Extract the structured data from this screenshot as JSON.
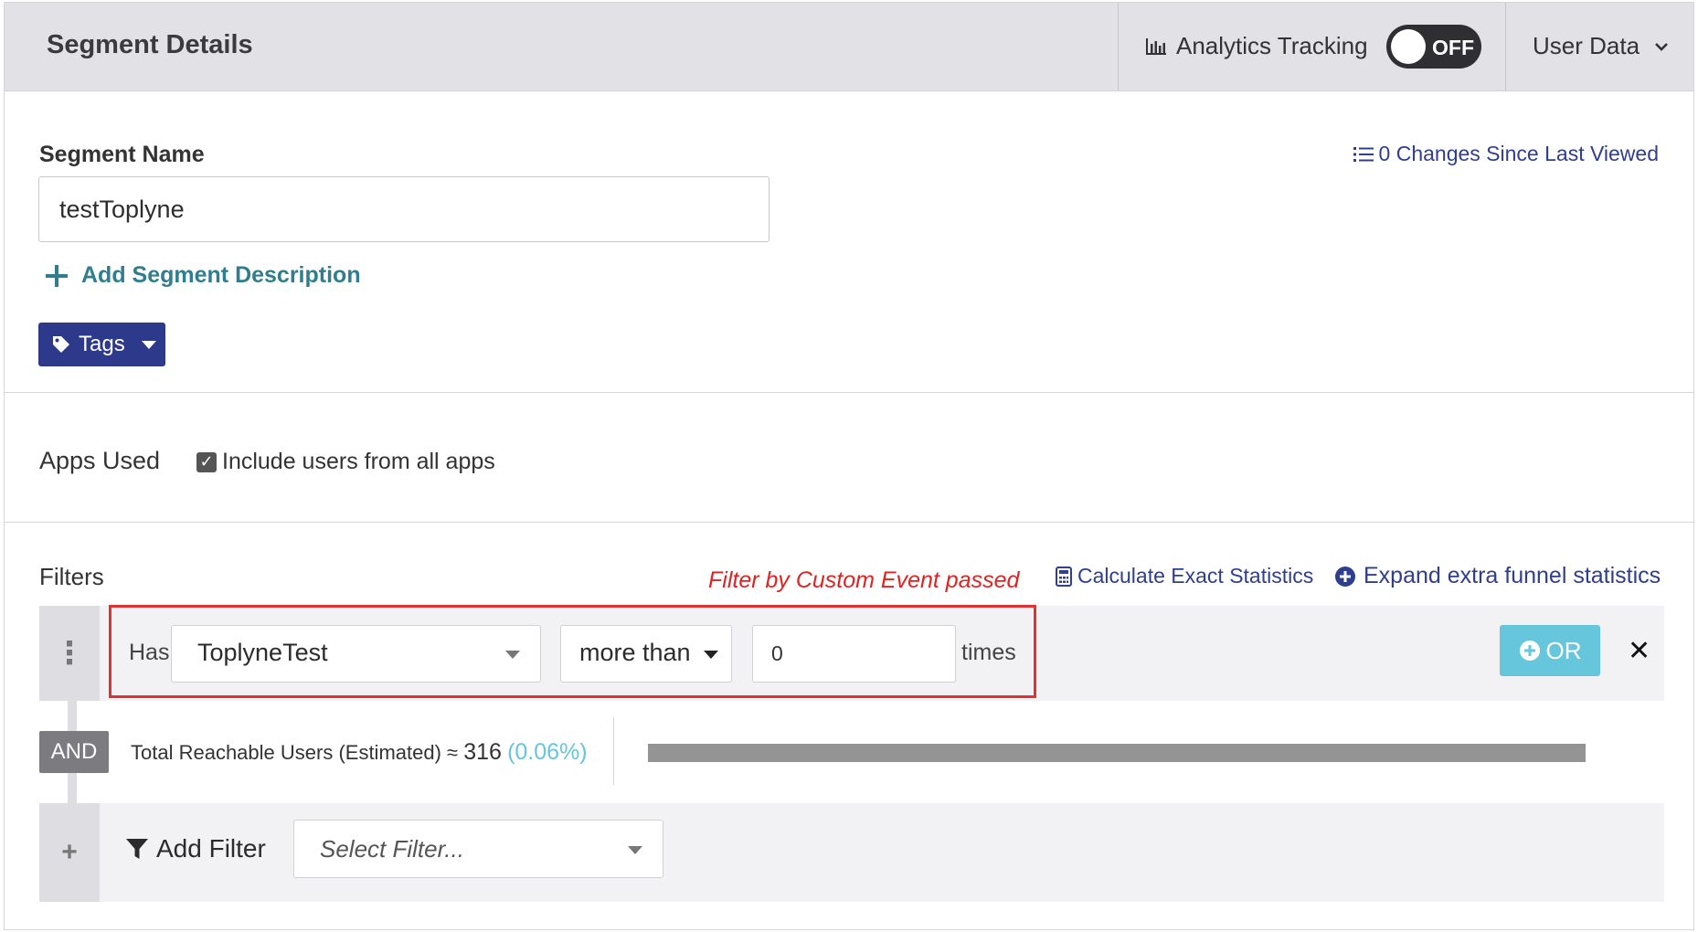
{
  "header": {
    "title": "Segment Details",
    "analytics_label": "Analytics Tracking",
    "toggle_state": "OFF",
    "user_data_label": "User Data"
  },
  "segment": {
    "name_label": "Segment Name",
    "name_value": "testToplyne",
    "changes_link": "0 Changes Since Last Viewed",
    "add_description": "Add Segment Description",
    "tags_label": "Tags"
  },
  "apps": {
    "label": "Apps Used",
    "checkbox_label": "Include users from all apps",
    "checked": true
  },
  "filters": {
    "label": "Filters",
    "annotation": "Filter by Custom Event passed",
    "calc_stats": "Calculate Exact Statistics",
    "expand_funnel": "Expand extra funnel statistics",
    "row": {
      "has": "Has",
      "event": "ToplyneTest",
      "operator": "more than",
      "count": "0",
      "times": "times",
      "or_label": "OR"
    },
    "and_label": "AND",
    "reach_label": "Total Reachable Users (Estimated) ≈",
    "reach_count": "316",
    "reach_pct": "(0.06%)",
    "add_filter_label": "Add Filter",
    "select_placeholder": "Select Filter..."
  },
  "colors": {
    "header_bg": "#e1e1e6",
    "primary": "#2d3a8c",
    "teal_link": "#2f7d8f",
    "or_button": "#65c6dc",
    "annotation_red": "#e12222"
  }
}
